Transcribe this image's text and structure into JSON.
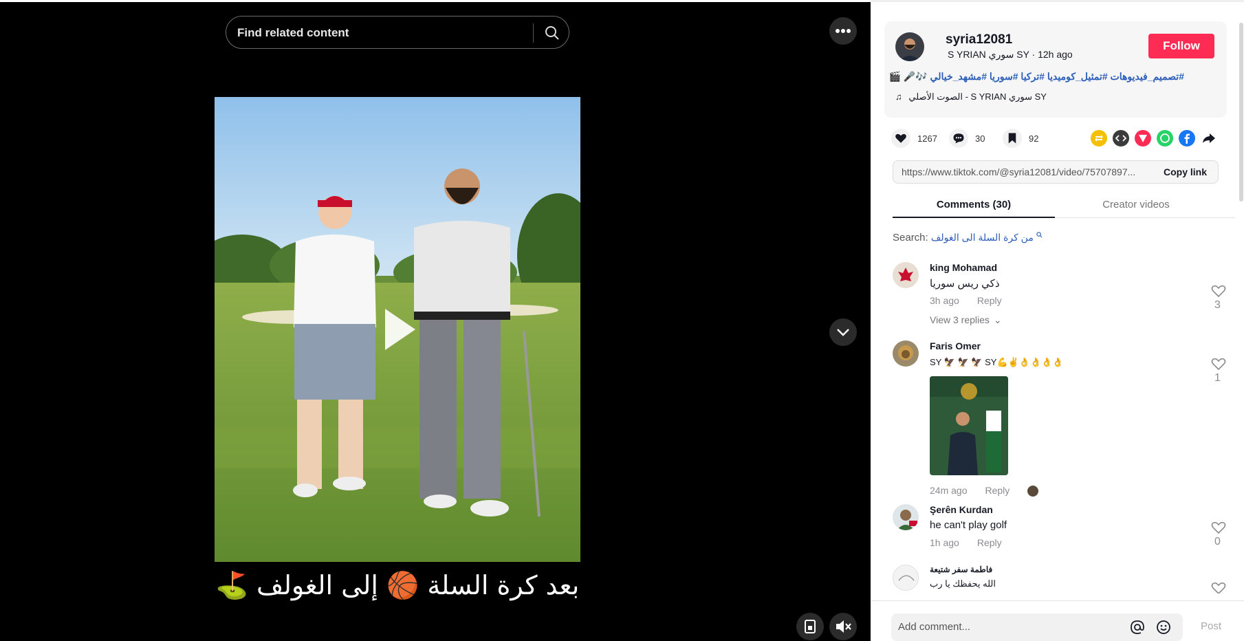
{
  "search": {
    "placeholder": "Find related content"
  },
  "video": {
    "caption": "بعد  كرة السلة 🏀 إلى الغولف ⛳"
  },
  "author": {
    "username": "syria12081",
    "subline": "S YRIAN سوري SY · 12h ago",
    "follow_label": "Follow"
  },
  "description": {
    "hashtags": "#تصميم_فيديوهات #تمثيل_كوميديا #تركيا #سوريا #مشهد_خيالي 🎶🎤 🎬",
    "music": "الصوت الأصلي  -  S YRIAN سوري SY"
  },
  "stats": {
    "likes": "1267",
    "comments": "30",
    "saves": "92"
  },
  "share_icons": [
    {
      "name": "repost-icon",
      "color": "#f5c000"
    },
    {
      "name": "embed-icon",
      "color": "#3b3b3b"
    },
    {
      "name": "send-icon",
      "color": "#fe2c55"
    },
    {
      "name": "whatsapp-icon",
      "color": "#25d366"
    },
    {
      "name": "facebook-icon",
      "color": "#1877f2"
    }
  ],
  "link": {
    "url": "https://www.tiktok.com/@syria12081/video/75707897...",
    "copy_label": "Copy link"
  },
  "tabs": {
    "comments": "Comments (30)",
    "creator_videos": "Creator videos"
  },
  "comment_search": {
    "label": "Search:",
    "query": "من كرة السلة الى الغولف"
  },
  "comments": [
    {
      "name": "king Mohamad",
      "text": "ذكي ريس سوريا",
      "time": "3h ago",
      "reply": "Reply",
      "likes": "3",
      "replies": "View 3 replies"
    },
    {
      "name": "Faris Omer",
      "text": "SY 🦅 🦅 🦅 SY💪✌️👌👌👌👌",
      "time": "24m ago",
      "reply": "Reply",
      "likes": "1"
    },
    {
      "name": "Şerên Kurdan",
      "text": "he can't play golf",
      "time": "1h ago",
      "reply": "Reply",
      "likes": "0"
    },
    {
      "name": "فاطمة سفر شتيعة",
      "text": "الله يحفظك يا رب",
      "time": "",
      "reply": "",
      "likes": ""
    }
  ],
  "footer": {
    "add_comment_placeholder": "Add comment...",
    "post_label": "Post"
  },
  "colors": {
    "accent": "#fe2c55",
    "link": "#2b5db9",
    "video_bg": "#000000"
  }
}
